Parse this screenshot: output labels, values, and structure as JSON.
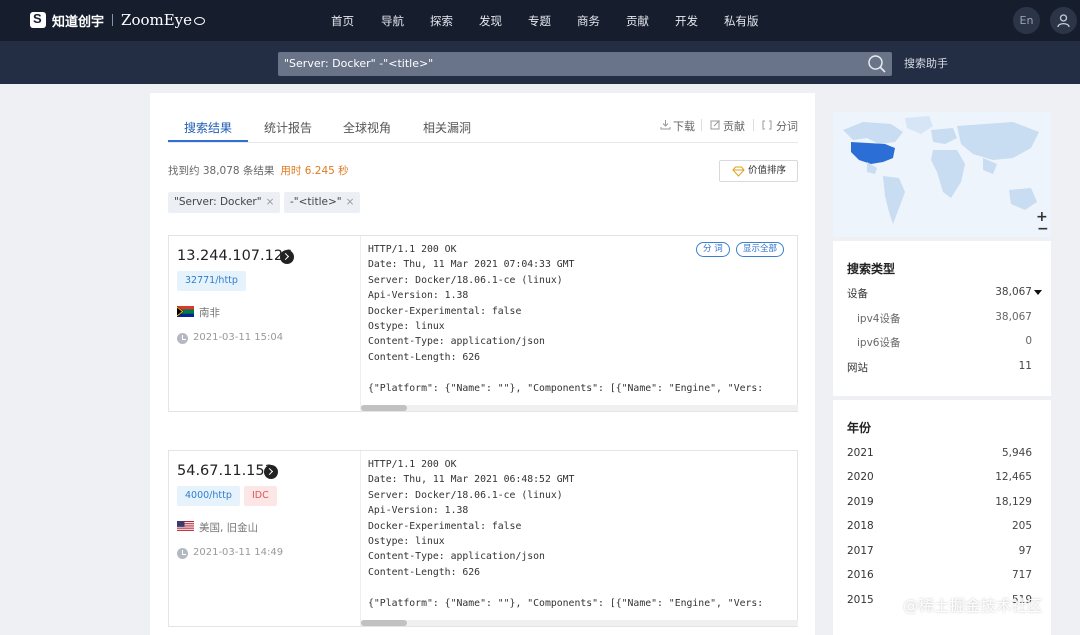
{
  "brand": {
    "cn_name": "知道创宇",
    "en_name": "ZoomEye"
  },
  "nav": [
    "首页",
    "导航",
    "探索",
    "发现",
    "专题",
    "商务",
    "贡献",
    "开发",
    "私有版"
  ],
  "header": {
    "lang_label": "En"
  },
  "search": {
    "query": "\"Server: Docker\" -\"<title>\"",
    "helper_label": "搜索助手"
  },
  "tabs": [
    "搜索结果",
    "统计报告",
    "全球视角",
    "相关漏洞"
  ],
  "tools": {
    "download": "下载",
    "contribute": "贡献",
    "segment": "分词"
  },
  "results_summary": {
    "count_text": "找到约 38,078 条结果",
    "time_text": "用时 6.245 秒"
  },
  "sort_label": "价值排序",
  "filters": [
    "\"Server: Docker\"",
    "-\"<title>\""
  ],
  "close_glyph": "×",
  "banner_buttons": {
    "segment": "分 词",
    "show_all": "显示全部"
  },
  "results": [
    {
      "ip": "13.244.107.126",
      "port_service": "32771/http",
      "idc": "",
      "location": "南非",
      "datetime": "2021-03-11 15:04",
      "banner": "HTTP/1.1 200 OK\nDate: Thu, 11 Mar 2021 07:04:33 GMT\nServer: Docker/18.06.1-ce (linux)\nApi-Version: 1.38\nDocker-Experimental: false\nOstype: linux\nContent-Type: application/json\nContent-Length: 626\n\n{\"Platform\": {\"Name\": \"\"}, \"Components\": [{\"Name\": \"Engine\", \"Vers:"
    },
    {
      "ip": "54.67.11.153",
      "port_service": "4000/http",
      "idc": "IDC",
      "location": "美国, 旧金山",
      "datetime": "2021-03-11 14:49",
      "banner": "HTTP/1.1 200 OK\nDate: Thu, 11 Mar 2021 06:48:52 GMT\nServer: Docker/18.06.1-ce (linux)\nApi-Version: 1.38\nDocker-Experimental: false\nOstype: linux\nContent-Type: application/json\nContent-Length: 626\n\n{\"Platform\": {\"Name\": \"\"}, \"Components\": [{\"Name\": \"Engine\", \"Vers:"
    }
  ],
  "sidebar": {
    "map": {
      "zoom_in": "+",
      "zoom_out": "−"
    },
    "search_type": {
      "title": "搜索类型",
      "rows": [
        {
          "label": "设备",
          "value": "38,067"
        },
        {
          "label": "ipv4设备",
          "value": "38,067"
        },
        {
          "label": "ipv6设备",
          "value": "0"
        },
        {
          "label": "网站",
          "value": "11"
        }
      ]
    },
    "year": {
      "title": "年份",
      "rows": [
        {
          "label": "2021",
          "value": "5,946"
        },
        {
          "label": "2020",
          "value": "12,465"
        },
        {
          "label": "2019",
          "value": "18,129"
        },
        {
          "label": "2018",
          "value": "205"
        },
        {
          "label": "2017",
          "value": "97"
        },
        {
          "label": "2016",
          "value": "717"
        },
        {
          "label": "2015",
          "value": "519"
        }
      ]
    }
  },
  "watermark": "@稀土掘金技术社区",
  "colors": {
    "nav_bg": "#161e2e",
    "search_bg": "#232d43",
    "accent_blue": "#2f6fcf",
    "time_orange": "#e07a1f",
    "idc_red": "#e05555"
  }
}
